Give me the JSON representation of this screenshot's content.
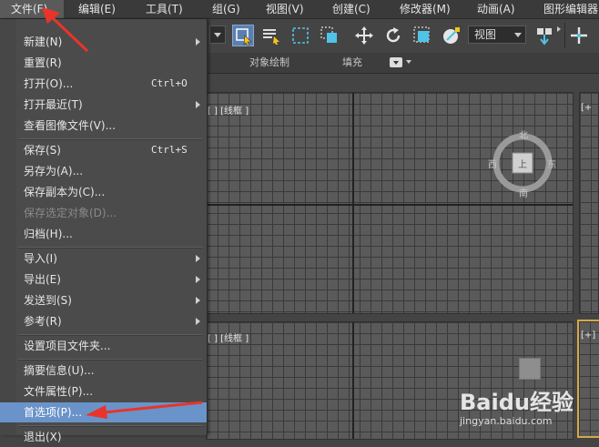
{
  "menubar": {
    "items": [
      {
        "label": "文件(F)"
      },
      {
        "label": "编辑(E)"
      },
      {
        "label": "工具(T)"
      },
      {
        "label": "组(G)"
      },
      {
        "label": "视图(V)"
      },
      {
        "label": "创建(C)"
      },
      {
        "label": "修改器(M)"
      },
      {
        "label": "动画(A)"
      },
      {
        "label": "图形编辑器"
      }
    ]
  },
  "toolbar": {
    "view_select_value": "视图"
  },
  "ribbon": {
    "object_paint": "对象绘制",
    "fill": "填充"
  },
  "viewports": {
    "top_left_label": "[ ] [线框 ]",
    "top_right_label": "[+",
    "bottom_left_label": "[ ] [线框 ]",
    "bottom_right_label": "[+]",
    "viewcube": {
      "north": "北",
      "south": "南",
      "east": "东",
      "west": "西",
      "face": "上"
    }
  },
  "file_menu": {
    "items": [
      {
        "label": "新建(N)",
        "shortcut": "",
        "submenu": true
      },
      {
        "label": "重置(R)",
        "shortcut": "",
        "submenu": false
      },
      {
        "label": "打开(O)...",
        "shortcut": "Ctrl+O",
        "submenu": false
      },
      {
        "label": "打开最近(T)",
        "shortcut": "",
        "submenu": true
      },
      {
        "label": "查看图像文件(V)...",
        "shortcut": "",
        "submenu": false
      },
      {
        "label": "保存(S)",
        "shortcut": "Ctrl+S",
        "submenu": false
      },
      {
        "label": "另存为(A)...",
        "shortcut": "",
        "submenu": false
      },
      {
        "label": "保存副本为(C)...",
        "shortcut": "",
        "submenu": false
      },
      {
        "label": "保存选定对象(D)...",
        "shortcut": "",
        "submenu": false,
        "disabled": true
      },
      {
        "label": "归档(H)...",
        "shortcut": "",
        "submenu": false
      },
      {
        "label": "导入(I)",
        "shortcut": "",
        "submenu": true
      },
      {
        "label": "导出(E)",
        "shortcut": "",
        "submenu": true
      },
      {
        "label": "发送到(S)",
        "shortcut": "",
        "submenu": true
      },
      {
        "label": "参考(R)",
        "shortcut": "",
        "submenu": true
      },
      {
        "label": "设置项目文件夹...",
        "shortcut": "",
        "submenu": false
      },
      {
        "label": "摘要信息(U)...",
        "shortcut": "",
        "submenu": false
      },
      {
        "label": "文件属性(P)...",
        "shortcut": "",
        "submenu": false
      },
      {
        "label": "首选项(P)...",
        "shortcut": "",
        "submenu": false,
        "highlighted": true
      },
      {
        "label": "退出(X)",
        "shortcut": "",
        "submenu": false
      }
    ]
  },
  "watermark": {
    "brand": "Baidu经验",
    "url": "jingyan.baidu.com"
  },
  "colors": {
    "highlight": "#6a93c9",
    "annotation_arrow": "#e8342a",
    "active_viewport_border": "#d6a84a"
  }
}
